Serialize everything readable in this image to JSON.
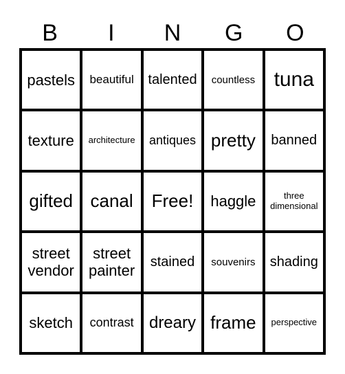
{
  "header": [
    "B",
    "I",
    "N",
    "G",
    "O"
  ],
  "rows": [
    [
      "pastels",
      "beautiful",
      "talented",
      "countless",
      "tuna"
    ],
    [
      "texture",
      "architecture",
      "antiques",
      "pretty",
      "banned"
    ],
    [
      "gifted",
      "canal",
      "Free!",
      "haggle",
      "three dimensional"
    ],
    [
      "street vendor",
      "street painter",
      "stained",
      "souvenirs",
      "shading"
    ],
    [
      "sketch",
      "contrast",
      "dreary",
      "frame",
      "perspective"
    ]
  ]
}
